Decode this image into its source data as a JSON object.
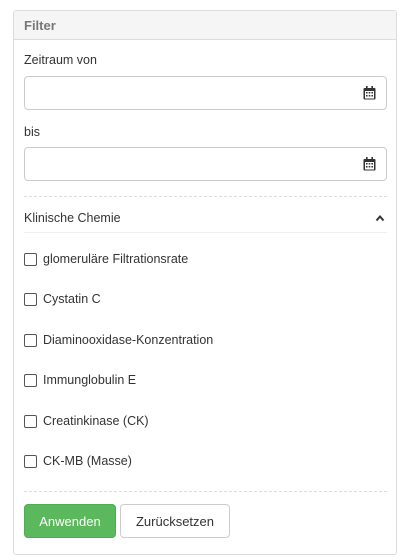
{
  "filter": {
    "title": "Filter",
    "date_from": {
      "label": "Zeitraum von",
      "value": "",
      "icon": "calendar-icon"
    },
    "date_to": {
      "label": "bis",
      "value": "",
      "icon": "calendar-icon"
    },
    "section": {
      "title": "Klinische Chemie",
      "expanded": true,
      "icon": "chevron-up-icon",
      "items": [
        {
          "label": "glomeruläre Filtrationsrate",
          "checked": false
        },
        {
          "label": "Cystatin C",
          "checked": false
        },
        {
          "label": "Diaminooxidase-Konzentration",
          "checked": false
        },
        {
          "label": "Immunglobulin E",
          "checked": false
        },
        {
          "label": "Creatinkinase (CK)",
          "checked": false
        },
        {
          "label": "CK-MB (Masse)",
          "checked": false
        }
      ]
    },
    "buttons": {
      "apply": "Anwenden",
      "reset": "Zurücksetzen"
    },
    "colors": {
      "apply_button": "#5cb85c",
      "header_bg": "#f5f5f5"
    }
  }
}
